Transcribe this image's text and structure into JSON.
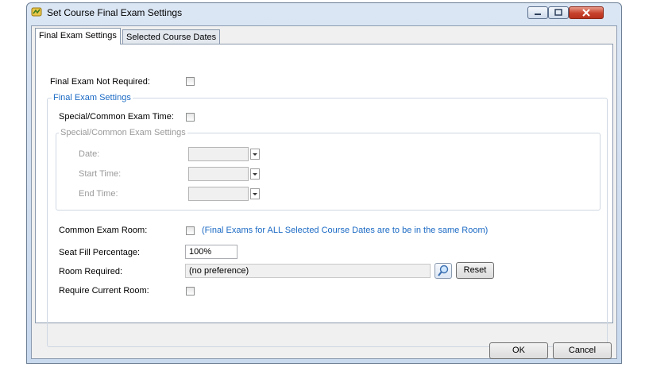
{
  "window": {
    "title": "Set Course Final Exam Settings",
    "icons": {
      "app": "yellow-course-icon",
      "minimize": "minimize-icon",
      "maximize": "maximize-icon",
      "close": "close-icon"
    }
  },
  "tabs": [
    {
      "label": "Final Exam Settings",
      "active": true
    },
    {
      "label": "Selected Course Dates",
      "active": false
    }
  ],
  "form": {
    "final_exam_not_required": {
      "label": "Final Exam Not Required:",
      "checked": false
    },
    "final_exam_settings_group": "Final Exam Settings",
    "special_common_exam_time": {
      "label": "Special/Common Exam Time:",
      "checked": false
    },
    "special_common_group": "Special/Common Exam Settings",
    "date_label": "Date:",
    "start_time_label": "Start Time:",
    "end_time_label": "End Time:",
    "common_exam_room": {
      "label": "Common Exam Room:",
      "checked": false,
      "note": "(Final Exams for ALL Selected Course Dates are to be in the same Room)"
    },
    "seat_fill": {
      "label": "Seat Fill Percentage:",
      "value": "100%"
    },
    "room_required": {
      "label": "Room Required:",
      "value": "(no preference)",
      "reset_label": "Reset"
    },
    "require_current_room": {
      "label": "Require Current Room:",
      "checked": false
    }
  },
  "buttons": {
    "ok": "OK",
    "cancel": "Cancel"
  },
  "colors": {
    "accent_text": "#1b6ac4",
    "disabled_text": "#9a9a9a",
    "close_button": "#c7412b"
  }
}
